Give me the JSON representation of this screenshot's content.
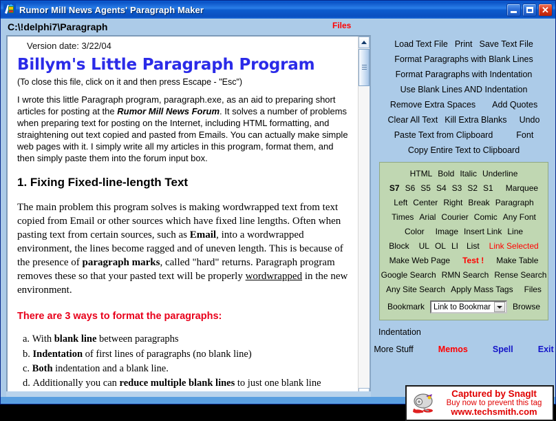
{
  "window": {
    "title": "Rumor Mill News Agents' Paragraph Maker",
    "icon": "app-icon",
    "minimize_label": "_",
    "maximize_label": "□",
    "close_label": "✕"
  },
  "pathbar": {
    "path": "C:\\!delphi7\\Paragraph",
    "files_link": "Files"
  },
  "document": {
    "version_line": "Version date: 3/22/04",
    "heading": "Billym's Little Paragraph Program",
    "close_note": "(To close this file, click on it and then press Escape - \"Esc\")",
    "intro_parts": {
      "p1": "I wrote this little Paragraph program, paragraph.exe, as an aid to preparing short articles for posting at the ",
      "p1_em": "Rumor Mill News Forum",
      "p2": ". It solves a number of problems when preparing text for posting on the Internet, including HTML formatting, and straightening out text copied and pasted from Emails. You can actually make simple web pages with it. I simply write all my articles in this program, format them, and then simply paste them into the forum input box."
    },
    "section_heading": "1. Fixing Fixed-line-length Text",
    "body_parts": {
      "b1": "The main problem this program solves is making wordwrapped text from text copied from Email or other sources which have fixed line lengths. Often when pasting text from certain sources, such as ",
      "b1_b": "Email",
      "b2": ",  into a wordwrapped environment, the lines become ragged and of uneven length. This is because of the presence of ",
      "b2_b": "paragraph marks",
      "b3": ", called \"hard\" returns. Paragraph program removes these so that your pasted text will be properly ",
      "b3_u": "wordwrapped",
      "b4": " in the new environment."
    },
    "red_heading": "There are 3 ways to format the paragraphs:",
    "list": [
      {
        "marker": "a.",
        "pre": "With ",
        "bold": "blank line",
        "post": " between paragraphs"
      },
      {
        "marker": "b.",
        "pre": "",
        "bold": "Indentation",
        "post": " of first lines of paragraphs (no blank line)"
      },
      {
        "marker": "c.",
        "pre": "",
        "bold": "Both",
        "post": " indentation and a blank line."
      },
      {
        "marker": "d.",
        "pre": "Additionally you can ",
        "bold": "reduce multiple blank lines",
        "post": " to just one blank line"
      }
    ]
  },
  "scrollbar": {
    "up_icon": "scroll-up-icon",
    "down_icon": "scroll-down-icon"
  },
  "toolbar_blue": {
    "row1": [
      "Load Text File",
      "Print",
      "Save Text File"
    ],
    "row2": [
      "Format Paragraphs with Blank Lines"
    ],
    "row3": [
      "Format Paragraphs with Indentation"
    ],
    "row4": [
      "Use Blank Lines AND Indentation"
    ],
    "row5": [
      "Remove Extra Spaces",
      "Add Quotes"
    ],
    "row6": [
      "Clear All Text",
      "Kill Extra Blanks",
      "Undo"
    ],
    "row7": [
      "Paste Text from Clipboard",
      "Font"
    ],
    "row8": [
      "Copy Entire Text to Clipboard"
    ]
  },
  "html_panel": {
    "row1": [
      "HTML",
      "Bold",
      "Italic",
      "Underline"
    ],
    "sizes": [
      "S7",
      "S6",
      "S5",
      "S4",
      "S3",
      "S2",
      "S1"
    ],
    "marquee": "Marquee",
    "row3": [
      "Left",
      "Center",
      "Right",
      "Break",
      "Paragraph"
    ],
    "row4": [
      "Times",
      "Arial",
      "Courier",
      "Comic",
      "Any Font"
    ],
    "row5": [
      "Color",
      "Image",
      "Insert Link",
      "Line"
    ],
    "row6": [
      "Block",
      "UL",
      "OL",
      "LI",
      "List"
    ],
    "link_selected": "Link Selected",
    "row7_left": "Make Web Page",
    "row7_mid": "Test !",
    "row7_right": "Make Table",
    "row8": [
      "Google Search",
      "RMN Search",
      "Rense Search"
    ],
    "row9": [
      "Any Site Search",
      "Apply Mass Tags",
      "Files"
    ],
    "bookmark_label": "Bookmark",
    "bookmark_value": "Link to Bookmar",
    "browse_label": "Browse"
  },
  "footer_panel": {
    "indentation_label": "Indentation",
    "more_stuff": "More Stuff",
    "memos": "Memos",
    "spell": "Spell",
    "exit": "Exit"
  },
  "watermark": {
    "line1": "Captured by SnagIt",
    "line2": "Buy now to prevent this tag",
    "line3": "www.techsmith.com",
    "icon": "snagit-mouse-icon"
  },
  "colors": {
    "panel_blue": "#ACCBE8",
    "panel_green": "#C0D7B2",
    "accent_red": "#FF0000",
    "heading_blue": "#2B2BE8",
    "title_blue": "#0A52C6"
  }
}
